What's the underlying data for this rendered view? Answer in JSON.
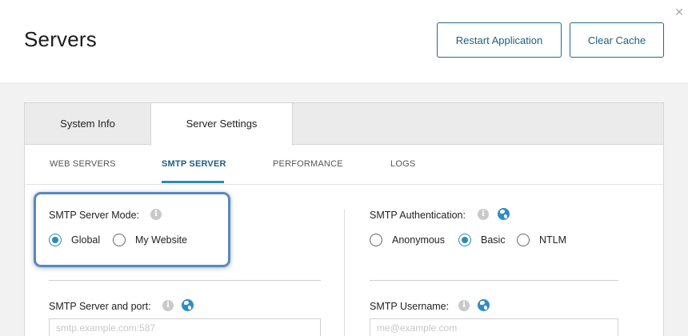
{
  "header": {
    "title": "Servers",
    "buttons": {
      "restart": "Restart Application",
      "clear_cache": "Clear Cache"
    },
    "close_icon": "✕"
  },
  "tabs": [
    {
      "label": "System Info",
      "active": false
    },
    {
      "label": "Server Settings",
      "active": true
    }
  ],
  "subtabs": [
    {
      "label": "WEB SERVERS",
      "active": false
    },
    {
      "label": "SMTP SERVER",
      "active": true
    },
    {
      "label": "PERFORMANCE",
      "active": false
    },
    {
      "label": "LOGS",
      "active": false
    }
  ],
  "smtp_mode": {
    "label": "SMTP Server Mode:",
    "info_icon": "i",
    "options": [
      {
        "label": "Global",
        "selected": true
      },
      {
        "label": "My Website",
        "selected": false
      }
    ]
  },
  "smtp_auth": {
    "label": "SMTP Authentication:",
    "info_icon": "i",
    "options": [
      {
        "label": "Anonymous",
        "selected": false
      },
      {
        "label": "Basic",
        "selected": true
      },
      {
        "label": "NTLM",
        "selected": false
      }
    ]
  },
  "smtp_server_port": {
    "label": "SMTP Server and port:",
    "info_icon": "i",
    "placeholder": "smtp.example.com:587"
  },
  "smtp_username": {
    "label": "SMTP Username:",
    "info_icon": "i",
    "placeholder": "me@example.com"
  },
  "colors": {
    "accent": "#2a8bb8",
    "button_border": "#1d6a8c",
    "highlight": "#5a86c0"
  }
}
